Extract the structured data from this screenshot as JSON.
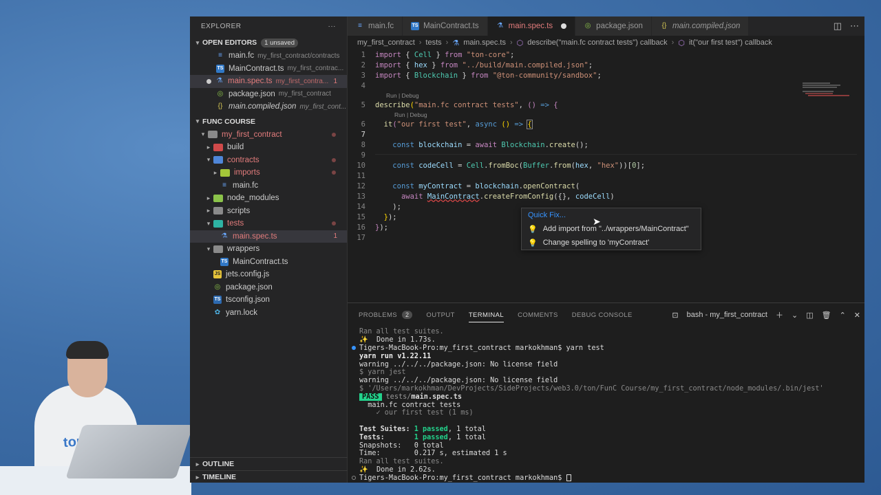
{
  "explorer": {
    "title": "EXPLORER",
    "more": "···",
    "open_editors": {
      "label": "OPEN EDITORS",
      "badge": "1 unsaved",
      "items": [
        {
          "name": "main.fc",
          "desc": "my_first_contract/contracts"
        },
        {
          "name": "MainContract.ts",
          "desc": "my_first_contrac..."
        },
        {
          "name": "main.spec.ts",
          "desc": "my_first_contra...",
          "count": "1"
        },
        {
          "name": "package.json",
          "desc": "my_first_contract"
        },
        {
          "name": "main.compiled.json",
          "desc": "my_first_cont..."
        }
      ]
    },
    "workspace": {
      "label": "FUNC COURSE",
      "items": [
        {
          "name": "my_first_contract"
        },
        {
          "name": "build"
        },
        {
          "name": "contracts"
        },
        {
          "name": "imports"
        },
        {
          "name": "main.fc"
        },
        {
          "name": "node_modules"
        },
        {
          "name": "scripts"
        },
        {
          "name": "tests"
        },
        {
          "name": "main.spec.ts",
          "count": "1"
        },
        {
          "name": "wrappers"
        },
        {
          "name": "MainContract.ts"
        },
        {
          "name": "jets.config.js"
        },
        {
          "name": "package.json"
        },
        {
          "name": "tsconfig.json"
        },
        {
          "name": "yarn.lock"
        }
      ]
    },
    "outline": "OUTLINE",
    "timeline": "TIMELINE"
  },
  "tabs": [
    {
      "label": "main.fc"
    },
    {
      "label": "MainContract.ts"
    },
    {
      "label": "main.spec.ts"
    },
    {
      "label": "package.json"
    },
    {
      "label": "main.compiled.json"
    }
  ],
  "breadcrumb": [
    "my_first_contract",
    "tests",
    "main.spec.ts",
    "describe(\"main.fc contract tests\") callback",
    "it(\"our first test\") callback"
  ],
  "code": {
    "lens1": "Run | Debug",
    "lens2": "Run | Debug",
    "line_numbers": [
      "1",
      "2",
      "3",
      "4",
      "5",
      "6",
      "7",
      "8",
      "9",
      "10",
      "11",
      "12",
      "13",
      "14",
      "15",
      "16",
      "17"
    ]
  },
  "quickfix": {
    "title": "Quick Fix...",
    "items": [
      "Add import from \"../wrappers/MainContract\"",
      "Change spelling to 'myContract'"
    ]
  },
  "panel": {
    "tabs": [
      {
        "label": "PROBLEMS",
        "badge": "2"
      },
      {
        "label": "OUTPUT"
      },
      {
        "label": "TERMINAL"
      },
      {
        "label": "COMMENTS"
      },
      {
        "label": "DEBUG CONSOLE"
      }
    ],
    "terminal_name": "bash - my_first_contract",
    "terminal": {
      "l1": "Ran all test suites.",
      "l2": "✨  Done in 1.73s.",
      "l3": "Tigers-MacBook-Pro:my_first_contract markokhman$ yarn test",
      "l4": "yarn run v1.22.11",
      "l5": "warning ../../../package.json: No license field",
      "l6": "$ yarn jest",
      "l7": "warning ../../../package.json: No license field",
      "l8": "$ '/Users/markokhman/DevProjects/SideProjects/web3.0/ton/FunC Course/my_first_contract/node_modules/.bin/jest'",
      "pass": "PASS",
      "l9_dir": "tests/",
      "l9_file": "main.spec.ts",
      "l10": "  main.fc contract tests",
      "l11": "    ✓ our first test (1 ms)",
      "suites_label": "Test Suites: ",
      "suites_passed": "1 passed",
      "suites_rest": ", 1 total",
      "tests_label": "Tests:       ",
      "tests_passed": "1 passed",
      "tests_rest": ", 1 total",
      "snap": "Snapshots:   0 total",
      "time": "Time:        0.217 s, estimated 1 s",
      "l12": "Ran all test suites.",
      "l13": "✨  Done in 2.62s.",
      "prompt": "Tigers-MacBook-Pro:my_first_contract markokhman$ "
    }
  },
  "overlay": {
    "logo": "ton"
  }
}
